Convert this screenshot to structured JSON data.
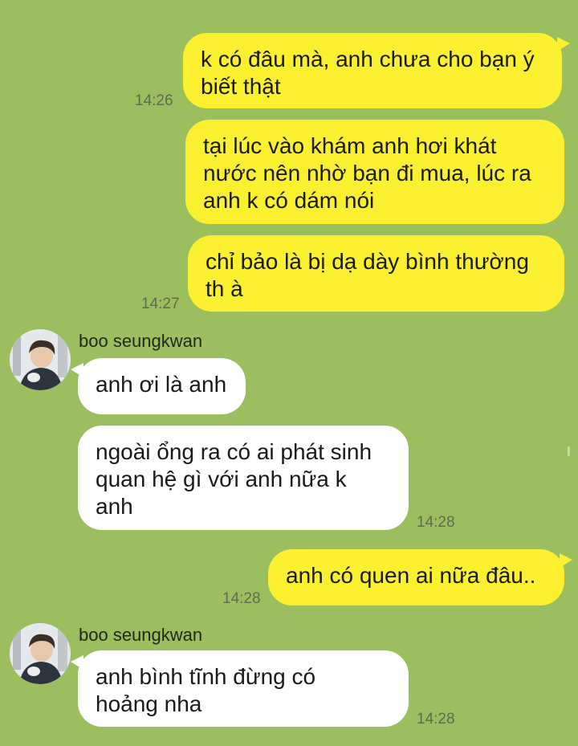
{
  "chat": {
    "contact_name": "boo seungkwan",
    "messages": [
      {
        "side": "out",
        "text": "k có đâu mà, anh chưa cho bạn ý\nbiết thật",
        "time": "14:26"
      },
      {
        "side": "out",
        "text": "tại lúc vào khám anh hơi khát\nnước nên nhờ bạn đi mua, lúc ra\nanh k có dám nói",
        "time": ""
      },
      {
        "side": "out",
        "text": "chỉ bảo là bị dạ dày bình thường\nth à",
        "time": "14:27"
      },
      {
        "side": "in",
        "text": "anh ơi là anh",
        "time": ""
      },
      {
        "side": "in",
        "text": "ngoài ổng ra có ai phát sinh\nquan hệ gì với anh nữa k\nanh",
        "time": "14:28"
      },
      {
        "side": "out",
        "text": "anh có quen ai nữa đâu..",
        "time": "14:28"
      },
      {
        "side": "in",
        "text": "anh bình tĩnh đừng có\nhoảng nha",
        "time": "14:28"
      }
    ]
  },
  "colors": {
    "background": "#9bbf5e",
    "outgoing_bubble": "#fbf02f",
    "incoming_bubble": "#ffffff"
  }
}
